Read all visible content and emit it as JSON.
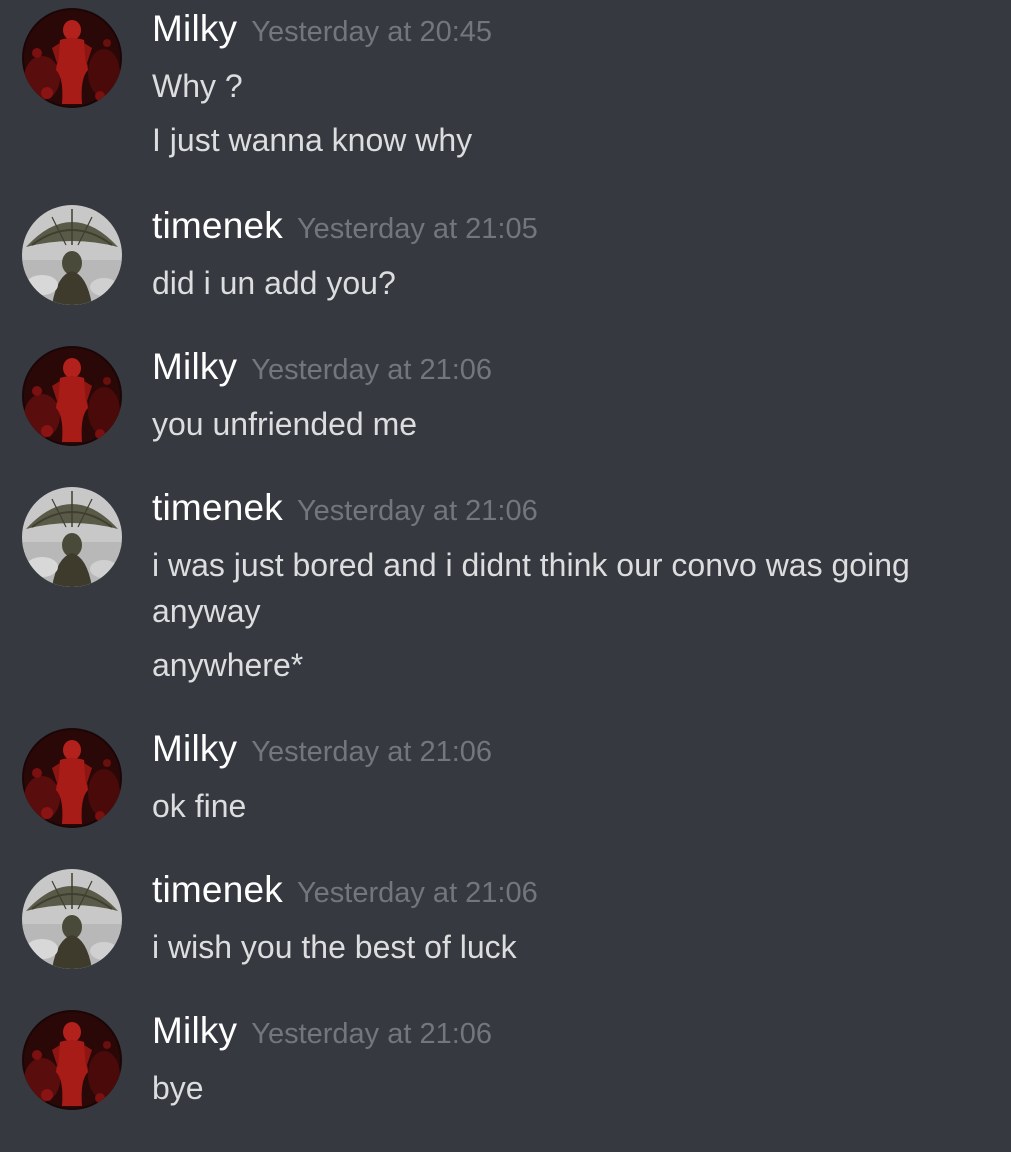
{
  "colors": {
    "background": "#36393f",
    "username": "#ffffff",
    "timestamp": "#72767d",
    "message_text": "#dcddde"
  },
  "messages": [
    {
      "author": "Milky",
      "timestamp": "Yesterday at 20:45",
      "avatar_icon": "milky-avatar-red",
      "lines": [
        "Why ?",
        "I just wanna know why"
      ]
    },
    {
      "author": "timenek",
      "timestamp": "Yesterday at 21:05",
      "avatar_icon": "timenek-avatar-umbrella",
      "lines": [
        "did i un add you?"
      ]
    },
    {
      "author": "Milky",
      "timestamp": "Yesterday at 21:06",
      "avatar_icon": "milky-avatar-red",
      "lines": [
        "you unfriended me"
      ]
    },
    {
      "author": "timenek",
      "timestamp": "Yesterday at 21:06",
      "avatar_icon": "timenek-avatar-umbrella",
      "lines": [
        "i was just bored and i didnt think our convo was going",
        "anyway",
        "anywhere*"
      ]
    },
    {
      "author": "Milky",
      "timestamp": "Yesterday at 21:06",
      "avatar_icon": "milky-avatar-red",
      "lines": [
        "ok fine"
      ]
    },
    {
      "author": "timenek",
      "timestamp": "Yesterday at 21:06",
      "avatar_icon": "timenek-avatar-umbrella",
      "lines": [
        "i wish you the best of luck"
      ]
    },
    {
      "author": "Milky",
      "timestamp": "Yesterday at 21:06",
      "avatar_icon": "milky-avatar-red",
      "lines": [
        "bye"
      ]
    }
  ]
}
